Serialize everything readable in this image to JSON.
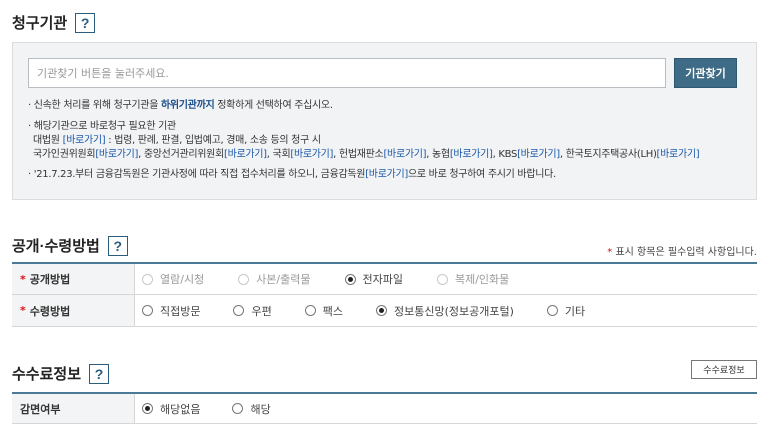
{
  "claim_agency": {
    "title": "청구기관",
    "help": "?",
    "search_placeholder": "기관찾기 버튼을 눌러주세요.",
    "search_button": "기관찾기",
    "note1_pre": "· 신속한 처리를 위해 청구기관을 ",
    "note1_bold": "하위기관까지",
    "note1_post": " 정확하게 선택하여 주십시오.",
    "note2_line1": "· 해당기관으로 바로청구 필요한 기관",
    "note2_line2_pre": "대법원 ",
    "note2_line2_post": " : 법령, 판례, 판결, 입법예고, 경매, 소송 등의 청구 시",
    "link": "[바로가기]",
    "note2_line3": [
      "국가인권위원회",
      ", 중앙선거관리위원회",
      ", 국회",
      ", 헌법재판소",
      ", 농협",
      ", KBS",
      ", 한국토지주택공사(LH)"
    ],
    "note3_pre": "· '21.7.23.부터 금융감독원은 기관사정에 따라 직접 접수처리를 하오니, 금융감독원",
    "note3_post": "으로 바로 청구하여 주시기 바랍니다."
  },
  "disclosure": {
    "title": "공개·수령방법",
    "help": "?",
    "required_note_star": "*",
    "required_note": " 표시 항목은 필수입력 사항입니다.",
    "rows": [
      {
        "label": "공개방법",
        "options": [
          {
            "label": "열람/시청",
            "selected": false,
            "disabled": true
          },
          {
            "label": "사본/출력물",
            "selected": false,
            "disabled": true
          },
          {
            "label": "전자파일",
            "selected": true,
            "disabled": false
          },
          {
            "label": "복제/인화물",
            "selected": false,
            "disabled": true
          }
        ]
      },
      {
        "label": "수령방법",
        "options": [
          {
            "label": "직접방문",
            "selected": false,
            "disabled": false
          },
          {
            "label": "우편",
            "selected": false,
            "disabled": false
          },
          {
            "label": "팩스",
            "selected": false,
            "disabled": false
          },
          {
            "label": "정보통신망(정보공개포털)",
            "selected": true,
            "disabled": false
          },
          {
            "label": "기타",
            "selected": false,
            "disabled": false
          }
        ]
      }
    ]
  },
  "fee": {
    "title": "수수료정보",
    "help": "?",
    "button": "수수료정보",
    "row_label": "감면여부",
    "options": [
      {
        "label": "해당없음",
        "selected": true
      },
      {
        "label": "해당",
        "selected": false
      }
    ]
  }
}
